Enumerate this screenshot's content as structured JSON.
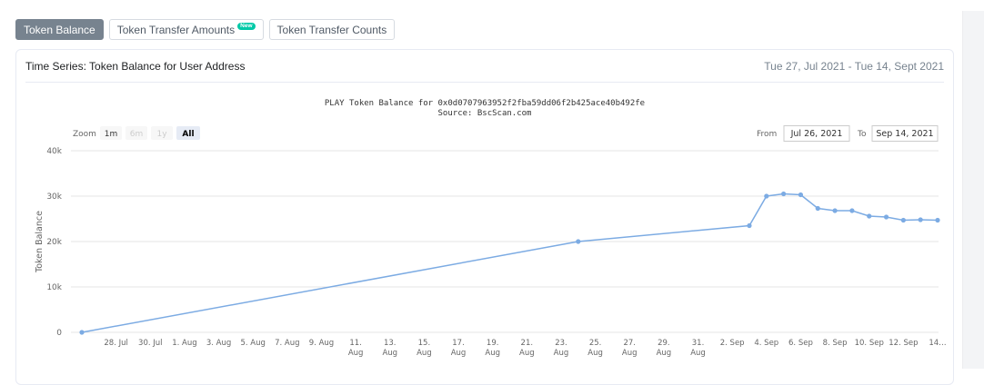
{
  "tabs": [
    {
      "label": "Token Balance",
      "active": true
    },
    {
      "label": "Token Transfer Amounts",
      "badge": "New"
    },
    {
      "label": "Token Transfer Counts"
    }
  ],
  "card": {
    "title": "Time Series: Token Balance for User Address",
    "date_range": "Tue 27, Jul 2021 - Tue 14, Sept 2021"
  },
  "zoom": {
    "label": "Zoom",
    "buttons": [
      {
        "label": "1m",
        "state": "normal"
      },
      {
        "label": "6m",
        "state": "disabled"
      },
      {
        "label": "1y",
        "state": "disabled"
      },
      {
        "label": "All",
        "state": "selected"
      }
    ]
  },
  "range_inputs": {
    "from_label": "From",
    "from_value": "Jul 26, 2021",
    "to_label": "To",
    "to_value": "Sep 14, 2021"
  },
  "colors": {
    "series": "#7cabe3",
    "tab_active": "#77838f",
    "badge": "#00c9a7"
  },
  "chart_data": {
    "type": "line",
    "title": "PLAY Token Balance for 0x0d0707963952f2fba59dd06f2b425ace40b492fe",
    "subtitle": "Source: BscScan.com",
    "xlabel": "",
    "ylabel": "Token Balance",
    "ylim": [
      0,
      40000
    ],
    "y_ticks": [
      0,
      10000,
      20000,
      30000,
      40000
    ],
    "y_tick_labels": [
      "0",
      "10k",
      "20k",
      "30k",
      "40k"
    ],
    "x_range": [
      "2021-07-26",
      "2021-09-14"
    ],
    "x_ticks": [
      {
        "date": "2021-07-28",
        "label": [
          "28. Jul"
        ]
      },
      {
        "date": "2021-07-30",
        "label": [
          "30. Jul"
        ]
      },
      {
        "date": "2021-08-01",
        "label": [
          "1. Aug"
        ]
      },
      {
        "date": "2021-08-03",
        "label": [
          "3. Aug"
        ]
      },
      {
        "date": "2021-08-05",
        "label": [
          "5. Aug"
        ]
      },
      {
        "date": "2021-08-07",
        "label": [
          "7. Aug"
        ]
      },
      {
        "date": "2021-08-09",
        "label": [
          "9. Aug"
        ]
      },
      {
        "date": "2021-08-11",
        "label": [
          "11.",
          "Aug"
        ]
      },
      {
        "date": "2021-08-13",
        "label": [
          "13.",
          "Aug"
        ]
      },
      {
        "date": "2021-08-15",
        "label": [
          "15.",
          "Aug"
        ]
      },
      {
        "date": "2021-08-17",
        "label": [
          "17.",
          "Aug"
        ]
      },
      {
        "date": "2021-08-19",
        "label": [
          "19.",
          "Aug"
        ]
      },
      {
        "date": "2021-08-21",
        "label": [
          "21.",
          "Aug"
        ]
      },
      {
        "date": "2021-08-23",
        "label": [
          "23.",
          "Aug"
        ]
      },
      {
        "date": "2021-08-25",
        "label": [
          "25.",
          "Aug"
        ]
      },
      {
        "date": "2021-08-27",
        "label": [
          "27.",
          "Aug"
        ]
      },
      {
        "date": "2021-08-29",
        "label": [
          "29.",
          "Aug"
        ]
      },
      {
        "date": "2021-08-31",
        "label": [
          "31.",
          "Aug"
        ]
      },
      {
        "date": "2021-09-02",
        "label": [
          "2. Sep"
        ]
      },
      {
        "date": "2021-09-04",
        "label": [
          "4. Sep"
        ]
      },
      {
        "date": "2021-09-06",
        "label": [
          "6. Sep"
        ]
      },
      {
        "date": "2021-09-08",
        "label": [
          "8. Sep"
        ]
      },
      {
        "date": "2021-09-10",
        "label": [
          "10. Sep"
        ]
      },
      {
        "date": "2021-09-12",
        "label": [
          "12. Sep"
        ]
      },
      {
        "date": "2021-09-14",
        "label": [
          "14…"
        ]
      }
    ],
    "grid": true,
    "series": [
      {
        "points": [
          {
            "x": "2021-07-26",
            "y": 0
          },
          {
            "x": "2021-08-24",
            "y": 20000
          },
          {
            "x": "2021-09-03",
            "y": 23500
          },
          {
            "x": "2021-09-04",
            "y": 30000
          },
          {
            "x": "2021-09-05",
            "y": 30500
          },
          {
            "x": "2021-09-06",
            "y": 30300
          },
          {
            "x": "2021-09-07",
            "y": 27300
          },
          {
            "x": "2021-09-08",
            "y": 26800
          },
          {
            "x": "2021-09-09",
            "y": 26800
          },
          {
            "x": "2021-09-10",
            "y": 25600
          },
          {
            "x": "2021-09-11",
            "y": 25400
          },
          {
            "x": "2021-09-12",
            "y": 24700
          },
          {
            "x": "2021-09-13",
            "y": 24800
          },
          {
            "x": "2021-09-14",
            "y": 24700
          }
        ]
      }
    ]
  }
}
